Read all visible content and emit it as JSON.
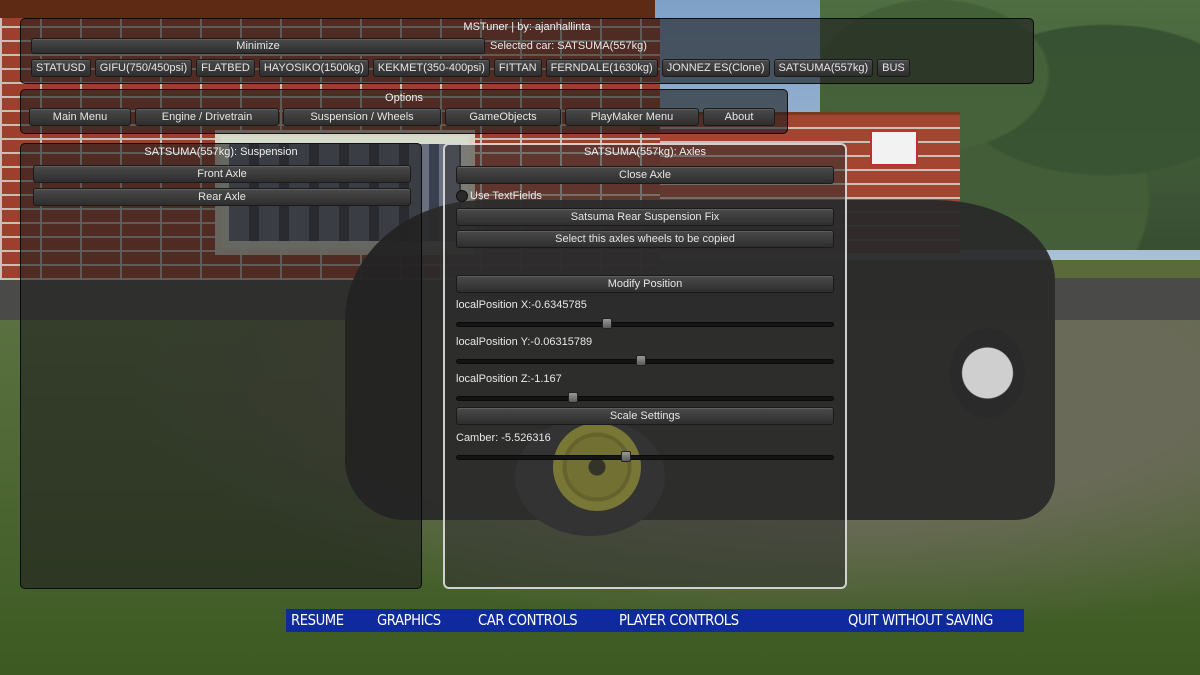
{
  "top_panel": {
    "title": "MSTuner | by: ajanhallinta",
    "minimize_label": "Minimize",
    "selected_car_text": "Selected car: SATSUMA(557kg)",
    "cars": [
      "STATUSD",
      "GIFU(750/450psi)",
      "FLATBED",
      "HAYOSIKO(1500kg)",
      "KEKMET(350-400psi)",
      "FITTAN",
      "FERNDALE(1630kg)",
      "JONNEZ ES(Clone)",
      "SATSUMA(557kg)",
      "BUS"
    ]
  },
  "options_panel": {
    "title": "Options",
    "tabs": [
      "Main Menu",
      "Engine / Drivetrain",
      "Suspension / Wheels",
      "GameObjects",
      "PlayMaker Menu",
      "About"
    ]
  },
  "suspension_panel": {
    "title": "SATSUMA(557kg): Suspension",
    "front_axle_label": "Front Axle",
    "rear_axle_label": "Rear Axle"
  },
  "axles_panel": {
    "title": "SATSUMA(557kg): Axles",
    "close_axle_label": "Close Axle",
    "use_textfields_label": "Use TextFields",
    "use_textfields_checked": false,
    "rear_fix_label": "Satsuma Rear Suspension Fix",
    "copy_wheels_label": "Select this axles wheels to be copied",
    "modify_position_label": "Modify Position",
    "sliders": [
      {
        "label": "localPosition X:-0.6345785",
        "fraction": 0.4
      },
      {
        "label": "localPosition Y:-0.06315789",
        "fraction": 0.49
      },
      {
        "label": "localPosition Z:-1.167",
        "fraction": 0.31
      }
    ],
    "scale_settings_label": "Scale Settings",
    "camber": {
      "label": "Camber: -5.526316",
      "fraction": 0.45
    }
  },
  "pause_menu": {
    "items": [
      "RESUME",
      "GRAPHICS",
      "CAR CONTROLS",
      "PLAYER CONTROLS",
      "QUIT WITHOUT SAVING"
    ],
    "background_color": "#0f2a9c"
  }
}
